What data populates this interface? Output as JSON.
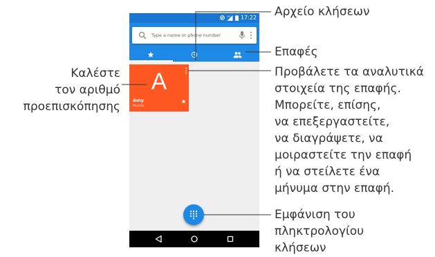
{
  "status": {
    "time": "17:22"
  },
  "search": {
    "placeholder": "Type a name or phone number"
  },
  "contact_card": {
    "letter": "A",
    "name": "Amy",
    "type": "Mobile"
  },
  "callouts": {
    "call_log": "Αρχείο κλήσεων",
    "contacts": "Επαφές",
    "call_preview": [
      "Καλέστε",
      "τον αριθμό",
      "προεπισκόπησης"
    ],
    "contact_details": [
      "Προβάλετε τα αναλυτικά",
      "στοιχεία της επαφής.",
      "Μπορείτε, επίσης,",
      "να επεξεργαστείτε,",
      "να διαγράψετε, να",
      "μοιραστείτε την επαφή",
      "ή να στείλετε ένα",
      "μήνυμα στην επαφή."
    ],
    "dialpad": [
      "Εμφάνιση του",
      "πληκτρολογίου",
      "κλήσεων"
    ]
  },
  "colors": {
    "primary": "#1e88e5",
    "status_bar": "#1976d2",
    "card": "#ff5722"
  },
  "icons": {
    "status": [
      "nfc-icon",
      "signal-icon",
      "battery-icon"
    ],
    "tabs": [
      "star-icon",
      "clock-icon",
      "people-icon"
    ],
    "nav": [
      "back-icon",
      "home-icon",
      "recents-icon"
    ],
    "fab": "dialpad-icon"
  }
}
